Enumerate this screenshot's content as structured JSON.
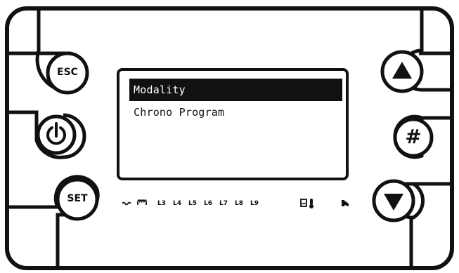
{
  "buttons": {
    "esc": {
      "label": "ESC"
    },
    "power": {
      "icon": "power-icon"
    },
    "set": {
      "label": "SET"
    },
    "up": {
      "icon": "triangle-up-icon"
    },
    "hash": {
      "label": "#"
    },
    "down": {
      "icon": "triangle-down-icon"
    }
  },
  "display": {
    "items": [
      {
        "label": "Modality",
        "selected": true
      },
      {
        "label": "Chrono Program",
        "selected": false
      }
    ]
  },
  "indicators": {
    "icons_left": [
      "fan-wave-icon",
      "heater-coil-icon"
    ],
    "labels": [
      "L3",
      "L4",
      "L5",
      "L6",
      "L7",
      "L8",
      "L9"
    ],
    "icons_right": [
      "tank-icon",
      "thermometer-icon",
      "water-pump-icon"
    ]
  },
  "colors": {
    "ink": "#111111",
    "background": "#ffffff"
  }
}
